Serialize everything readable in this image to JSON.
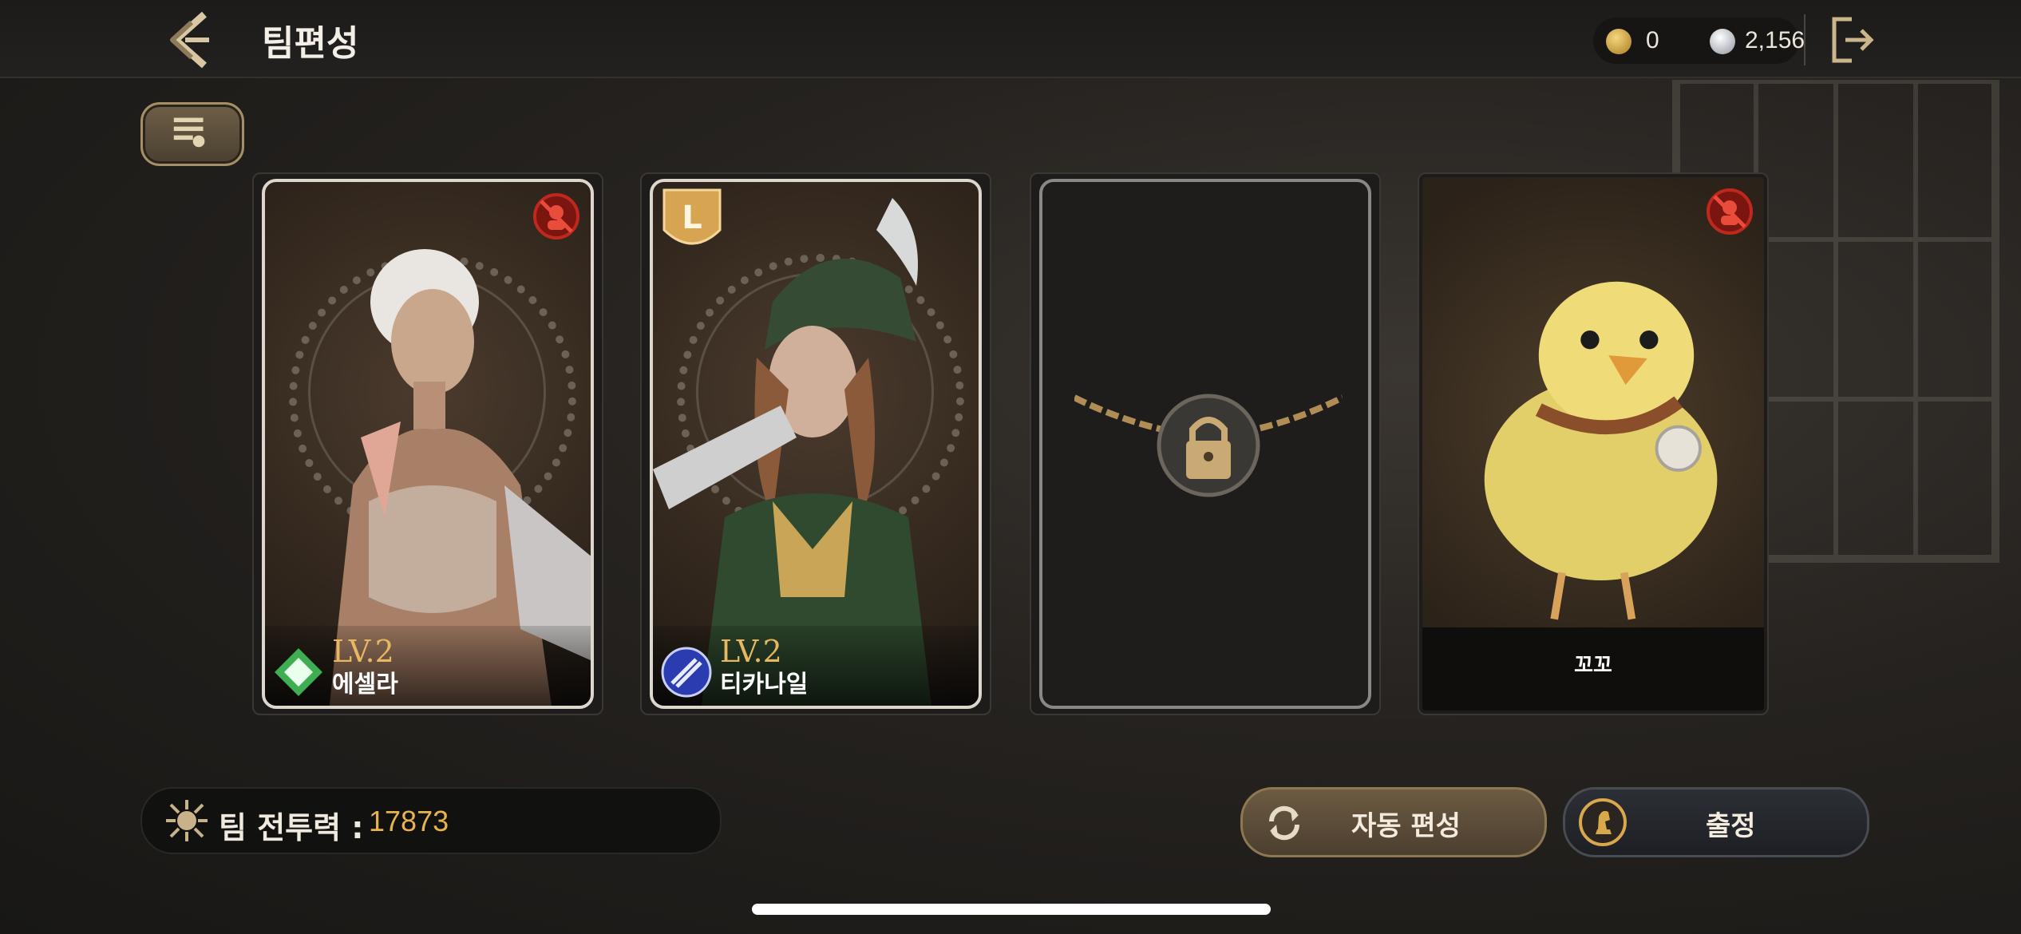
{
  "header": {
    "title": "팀편성",
    "gold_amount": "0",
    "silver_amount": "2,156"
  },
  "icons": {
    "back": "double-chevron-left-icon",
    "exit": "exit-door-icon",
    "deck": "deck-list-icon",
    "lock": "padlock-icon",
    "power": "team-power-emblem-icon",
    "auto": "refresh-icon",
    "dispatch": "chess-knight-icon"
  },
  "team": {
    "slots": [
      {
        "level": "LV.2",
        "name": "에셀라",
        "class_icon": "green-diamond-icon",
        "restricted": true,
        "rank": ""
      },
      {
        "level": "LV.2",
        "name": "티카나일",
        "class_icon": "blue-gun-icon",
        "restricted": false,
        "rank": "L"
      },
      {
        "locked": true
      },
      {
        "name": "꼬꼬",
        "type": "pet",
        "restricted": true
      }
    ]
  },
  "power": {
    "label": "팀 전투력 :",
    "value": "17873"
  },
  "buttons": {
    "auto_label": "자동 편성",
    "dispatch_label": "출정"
  },
  "colors": {
    "accent_gold": "#e8b24d",
    "level_gold": "#e8b860",
    "restrict_red": "#c0281e"
  }
}
